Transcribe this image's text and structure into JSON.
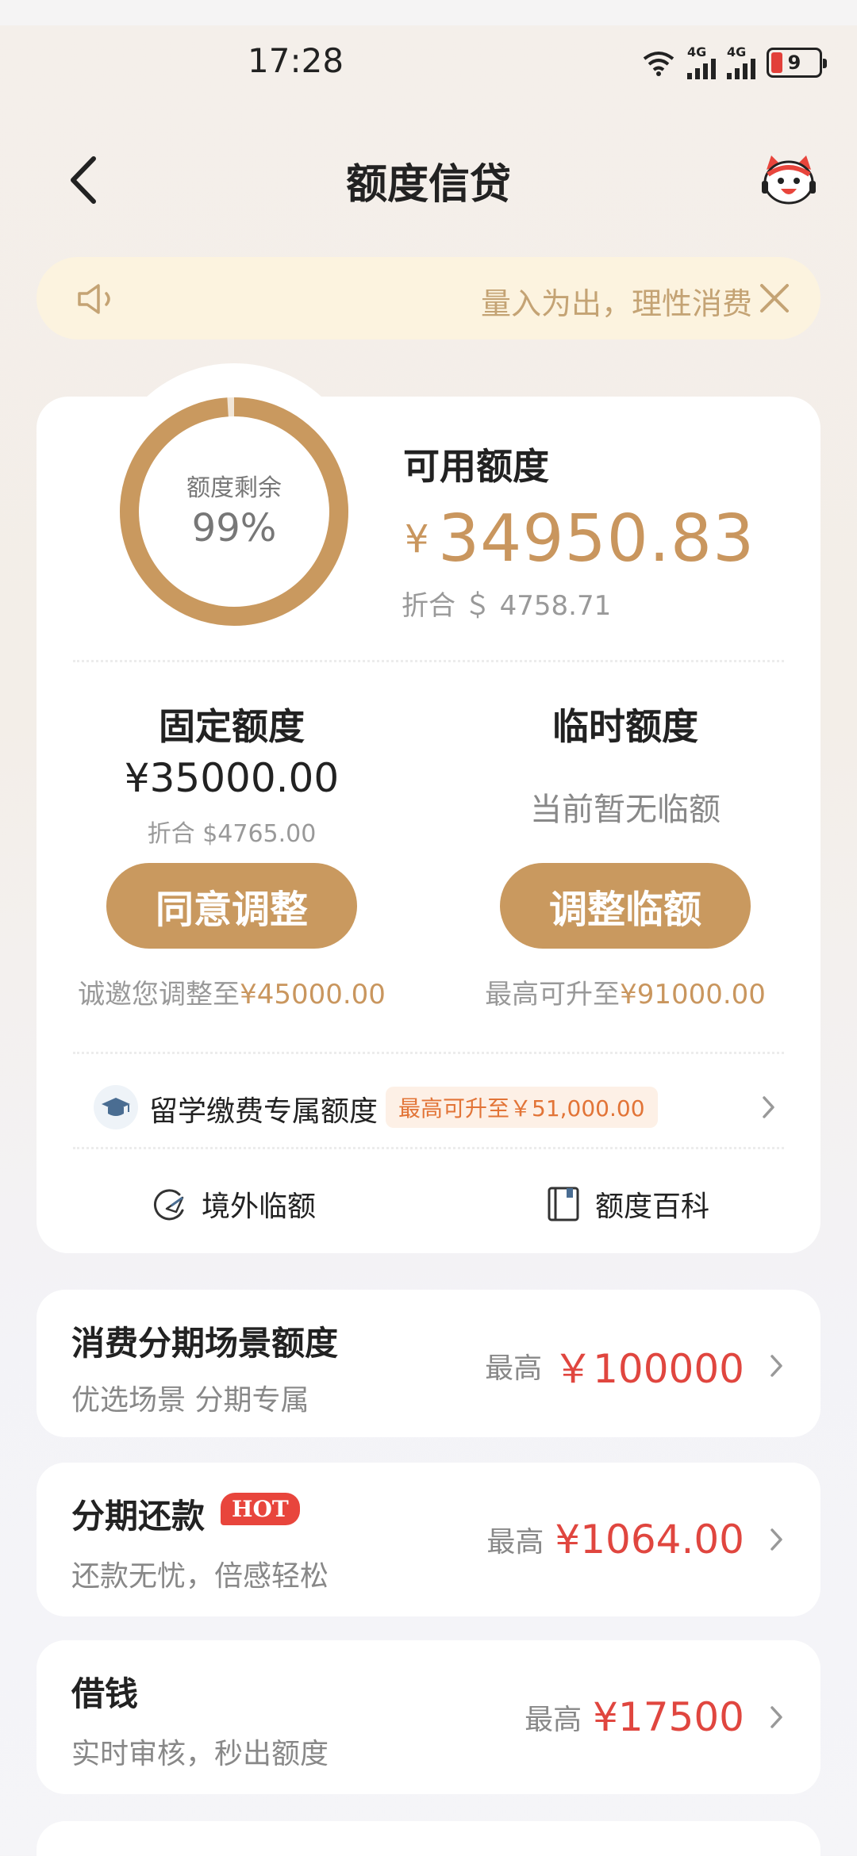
{
  "status_bar": {
    "time": "17:28",
    "net1": "4G",
    "net2": "4G",
    "battery": "9"
  },
  "header": {
    "title": "额度信贷"
  },
  "notice": {
    "text": "量入为出，理性消费"
  },
  "overview": {
    "ring_label": "额度剩余",
    "ring_percent": "99%",
    "ring_fraction": 0.99,
    "available_label": "可用额度",
    "currency": "¥",
    "available_amount": "34950.83",
    "available_conversion": "折合 ＄ 4758.71"
  },
  "fixed": {
    "title": "固定额度",
    "amount": "¥35000.00",
    "conversion": "折合 $4765.00",
    "button": "同意调整",
    "hint_prefix": "诚邀您调整至",
    "hint_amount": "¥45000.00"
  },
  "temporary": {
    "title": "临时额度",
    "status": "当前暂无临额",
    "button": "调整临额",
    "hint_prefix": "最高可升至",
    "hint_amount": "¥91000.00"
  },
  "study": {
    "label": "留学缴费专属额度",
    "badge": "最高可升至￥51,000.00"
  },
  "tools": {
    "overseas": "境外临额",
    "wiki": "额度百科"
  },
  "cards": [
    {
      "title": "消费分期场景额度",
      "subtitle": "优选场景 分期专属",
      "prefix": "最高",
      "amount": "￥100000"
    },
    {
      "title": "分期还款",
      "badge": "HOT",
      "subtitle": "还款无忧，倍感轻松",
      "prefix": "最高",
      "amount": "¥1064.00"
    },
    {
      "title": "借钱",
      "subtitle": "实时审核，秒出额度",
      "prefix": "最高",
      "amount": "¥17500"
    }
  ],
  "colors": {
    "accent_gold": "#c9995f",
    "amount_red": "#e0463f",
    "hot_red": "#e8453c",
    "notice_bg": "#fcf3df"
  }
}
